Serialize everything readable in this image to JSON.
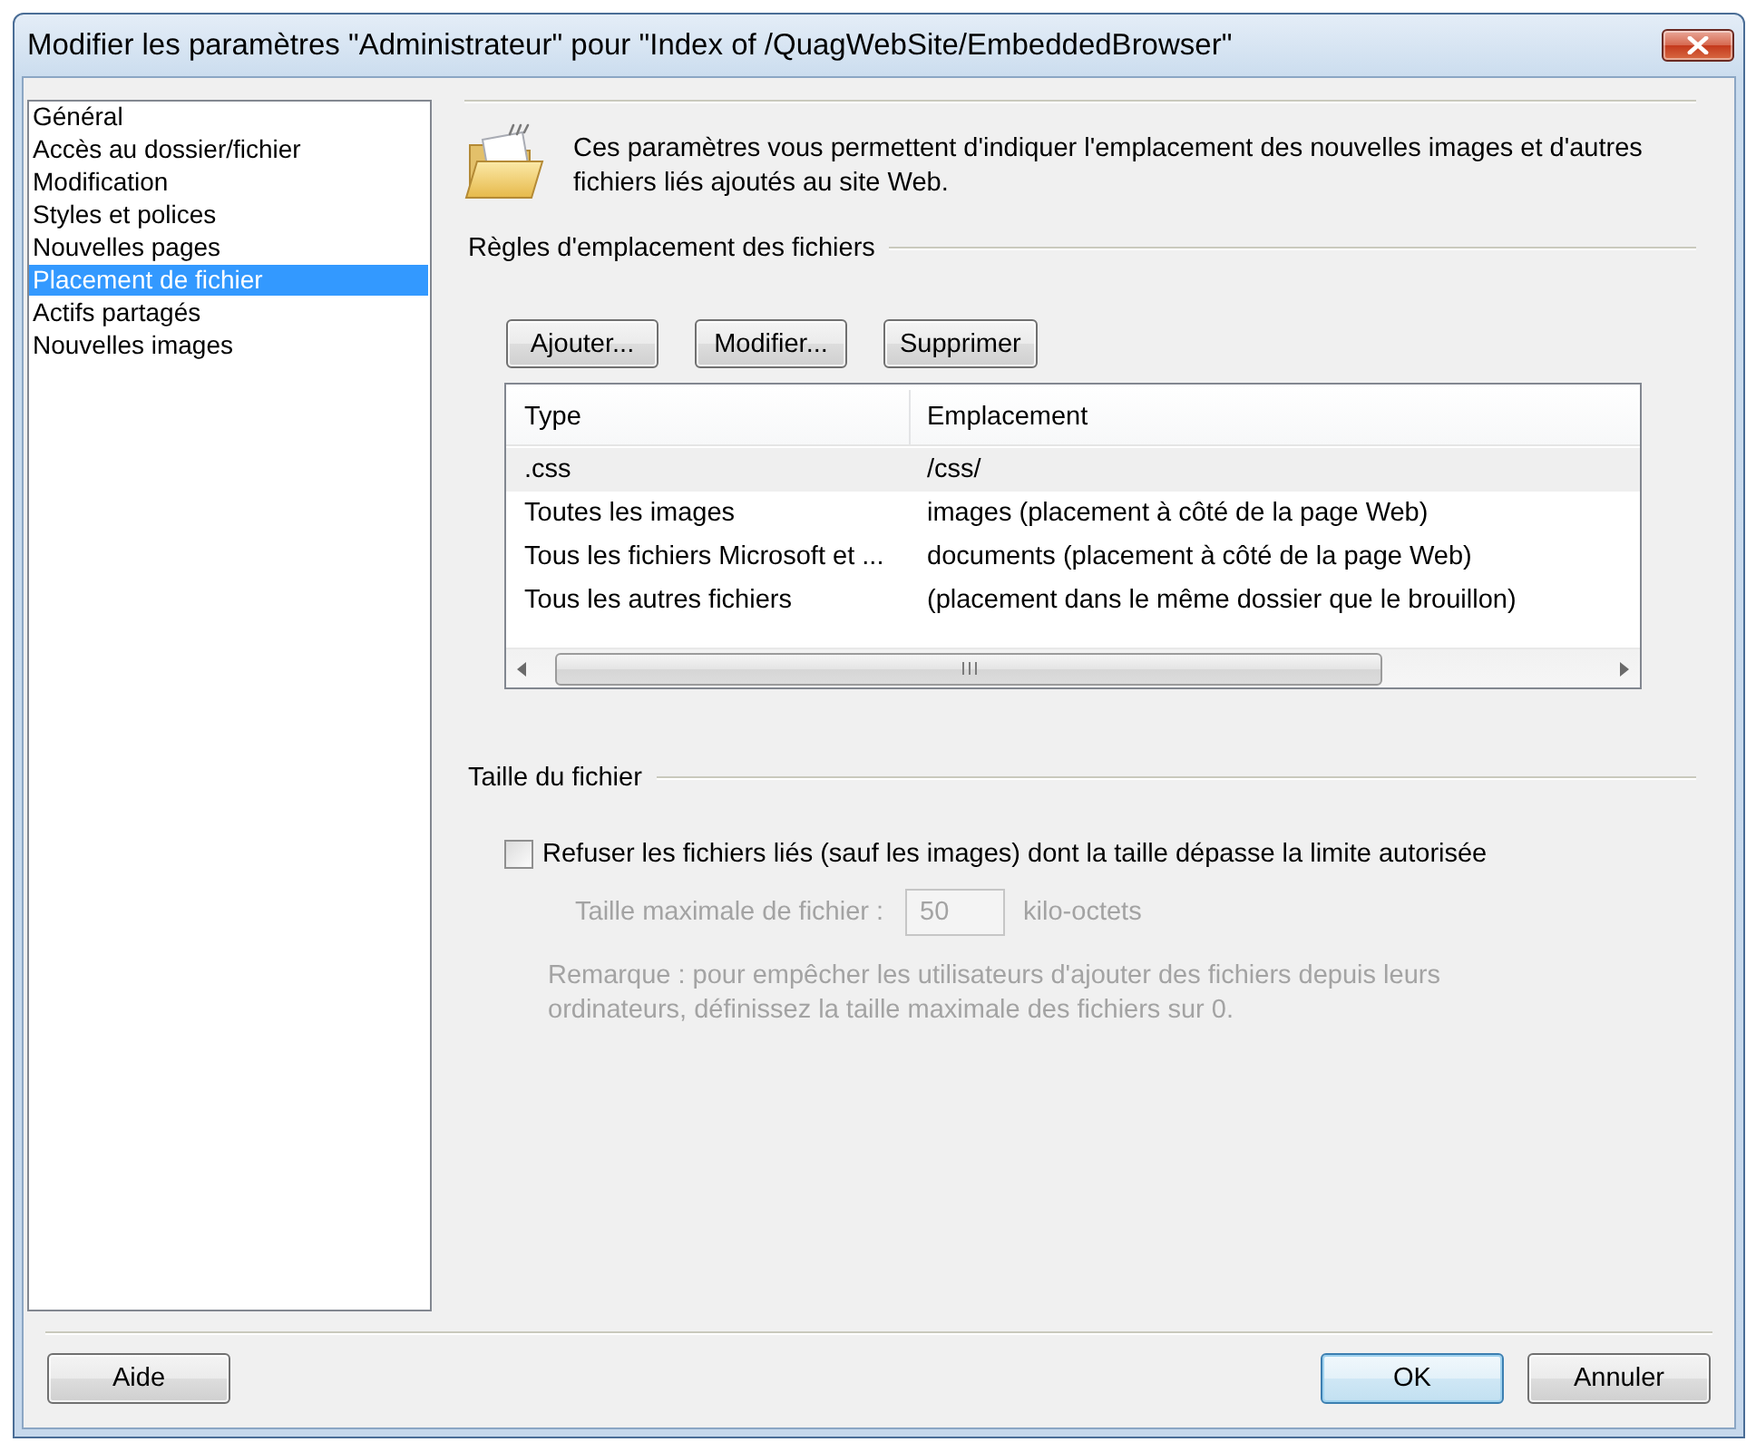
{
  "window": {
    "title": "Modifier les paramètres \"Administrateur\" pour \"Index of /QuagWebSite/EmbeddedBrowser\""
  },
  "sidebar": {
    "items": [
      {
        "label": "Général",
        "selected": false
      },
      {
        "label": "Accès au dossier/fichier",
        "selected": false
      },
      {
        "label": "Modification",
        "selected": false
      },
      {
        "label": "Styles et polices",
        "selected": false
      },
      {
        "label": "Nouvelles pages",
        "selected": false
      },
      {
        "label": "Placement de fichier",
        "selected": true
      },
      {
        "label": "Actifs partagés",
        "selected": false
      },
      {
        "label": "Nouvelles images",
        "selected": false
      }
    ]
  },
  "intro": {
    "text": "Ces paramètres vous permettent d'indiquer l'emplacement des nouvelles images et d'autres fichiers liés ajoutés au site Web."
  },
  "rules": {
    "heading": "Règles d'emplacement des fichiers",
    "buttons": [
      "Ajouter...",
      "Modifier...",
      "Supprimer"
    ],
    "table": {
      "columns": [
        "Type",
        "Emplacement"
      ],
      "rows": [
        {
          "cells": [
            ".css",
            "/css/"
          ],
          "selected": true
        },
        {
          "cells": [
            "Toutes les images",
            "images (placement à côté de la page Web)"
          ],
          "selected": false
        },
        {
          "cells": [
            "Tous les fichiers Microsoft et ...",
            "documents (placement à côté de la page Web)"
          ],
          "selected": false
        },
        {
          "cells": [
            "Tous les autres fichiers",
            "(placement dans le même dossier que le brouillon)"
          ],
          "selected": false
        }
      ]
    }
  },
  "file_size": {
    "heading": "Taille du fichier",
    "checkbox": {
      "label": "Refuser les fichiers liés (sauf les images) dont la taille dépasse la limite autorisée",
      "checked": false
    },
    "max_size": {
      "label": "Taille maximale de fichier :",
      "value": "50",
      "unit": "kilo-octets",
      "disabled": true
    },
    "note": {
      "text": "Remarque : pour empêcher les utilisateurs d'ajouter des fichiers depuis leurs ordinateurs, définissez la taille maximale des fichiers sur 0.",
      "disabled": true
    }
  },
  "footer": {
    "left_buttons": [
      {
        "label": "Aide",
        "default": false
      }
    ],
    "right_buttons": [
      {
        "label": "OK",
        "default": true
      },
      {
        "label": "Annuler",
        "default": false
      }
    ]
  }
}
